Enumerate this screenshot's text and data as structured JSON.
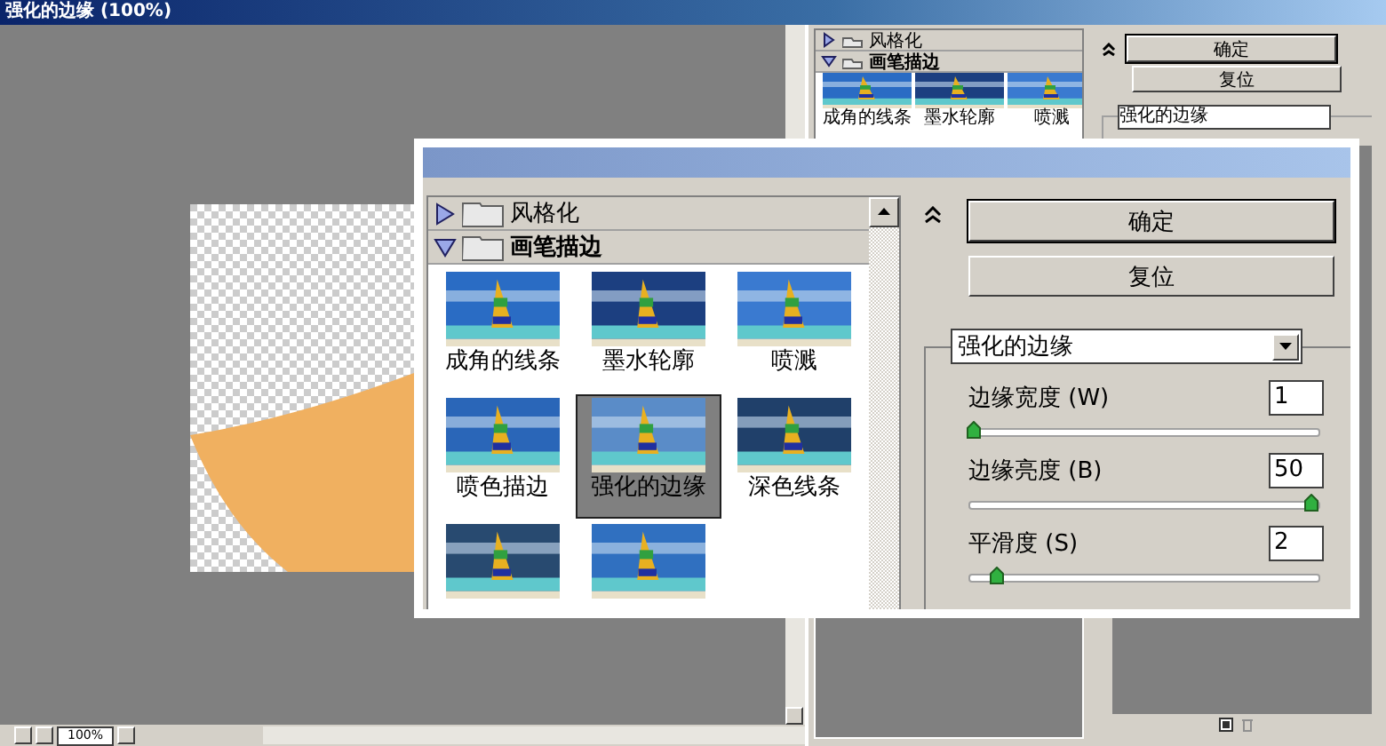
{
  "document": {
    "title": "强化的边缘 (100%)",
    "zoom": "100%"
  },
  "mini_gallery": {
    "categories": [
      {
        "name": "风格化",
        "expanded": false
      },
      {
        "name": "画笔描边",
        "expanded": true
      }
    ],
    "filters": [
      {
        "label": "成角的线条",
        "selected": false
      },
      {
        "label": "墨水轮廓",
        "selected": false
      },
      {
        "label": "喷溅",
        "selected": false
      }
    ]
  },
  "mini_controls": {
    "buttons": [
      "确定",
      "复位"
    ],
    "filter_select": "强化的边缘"
  },
  "gallery": {
    "categories": [
      {
        "name": "风格化",
        "expanded": false
      },
      {
        "name": "画笔描边",
        "expanded": true
      }
    ],
    "filters": [
      {
        "label": "成角的线条",
        "selected": false
      },
      {
        "label": "墨水轮廓",
        "selected": false
      },
      {
        "label": "喷溅",
        "selected": false
      },
      {
        "label": "喷色描边",
        "selected": false
      },
      {
        "label": "强化的边缘",
        "selected": true
      },
      {
        "label": "深色线条",
        "selected": false
      },
      {
        "selected": false
      },
      {
        "selected": false
      }
    ]
  },
  "controls": {
    "buttons": [
      "确定",
      "复位"
    ],
    "filter_select": "强化的边缘",
    "params": [
      {
        "label": "边缘宽度 (W)",
        "value": "1",
        "level": 0
      },
      {
        "label": "边缘亮度 (B)",
        "value": "50",
        "level": 1
      },
      {
        "label": "平滑度 (S)",
        "value": "2",
        "level": 0.07
      }
    ]
  }
}
